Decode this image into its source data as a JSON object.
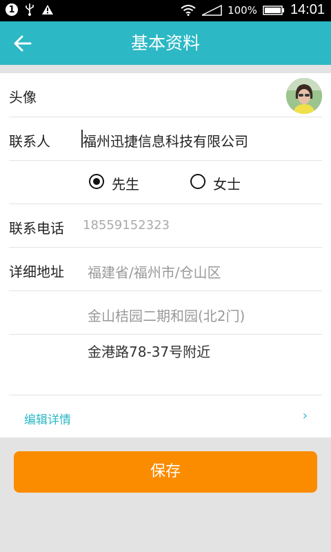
{
  "status_bar": {
    "notification_badge": "1",
    "battery_percent": "100%",
    "time": "14:01"
  },
  "app_bar": {
    "title": "基本资料"
  },
  "form": {
    "avatar_label": "头像",
    "contact_label": "联系人",
    "contact_value": "福州迅捷信息科技有限公司",
    "gender_options": [
      "先生",
      "女士"
    ],
    "gender_selected": "先生",
    "phone_label": "联系电话",
    "phone_placeholder": "18559152323",
    "address_label": "详细地址",
    "address_region": "福建省/福州市/仓山区",
    "address_line1": "金山桔园二期和园(北2门)",
    "address_line2": "金港路78-37号附近",
    "edit_details_label": "编辑详情",
    "edit_details_chevron": "›"
  },
  "save_button": {
    "label": "保存"
  },
  "colors": {
    "accent": "#2cb8c5",
    "save": "#fb8c00",
    "background": "#e3e3e3"
  }
}
